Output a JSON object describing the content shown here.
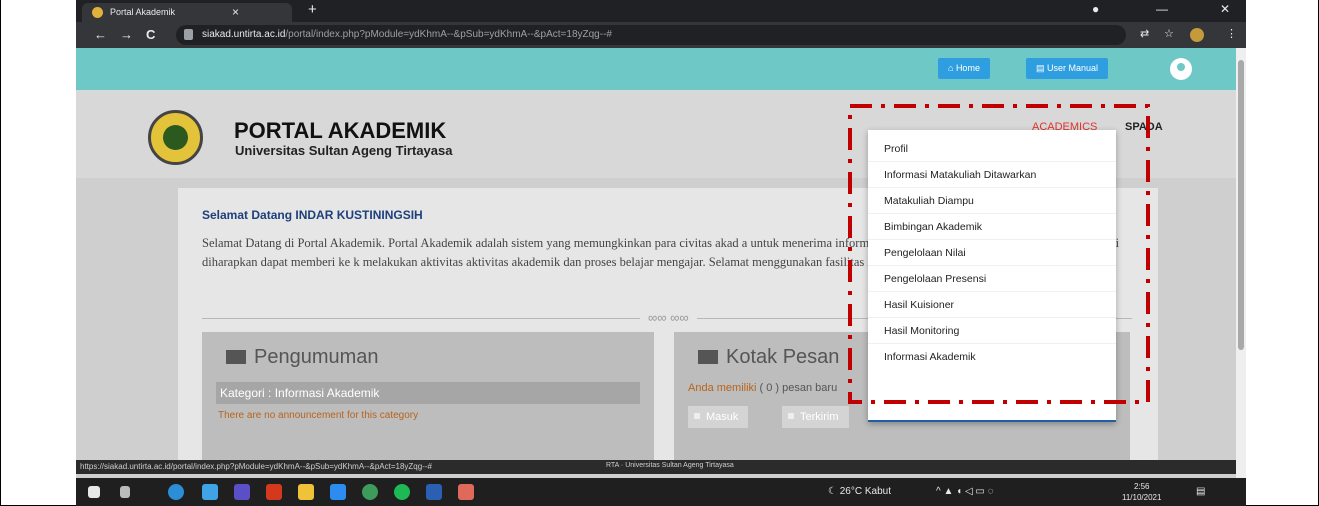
{
  "browser": {
    "tab_title": "Portal Akademik",
    "tab_close": "×",
    "new_tab": "+",
    "back": "←",
    "forward": "→",
    "reload": "C",
    "url_host": "siakad.untirta.ac.id",
    "url_path": "/portal/index.php?pModule=ydKhmA--&pSub=ydKhmA--&pAct=18yZqg--#",
    "win_min": "—",
    "win_max": "❐",
    "win_close": "✕"
  },
  "topbar": {
    "home_label": "Home",
    "manual_label": "User Manual"
  },
  "header": {
    "title": "PORTAL AKADEMIK",
    "subtitle": "Universitas Sultan Ageng Tirtayasa",
    "nav_academics": "ACADEMICS",
    "nav_spada": "SPADA"
  },
  "welcome": {
    "title": "Selamat Datang INDAR KUSTININGSIH",
    "text": "Selamat Datang di Portal Akademik. Portal Akademik adalah sistem yang memungkinkan para civitas akad a untuk menerima informasi dengan lebih cepat melalui Internet. Sistem ini diharapkan dapat memberi ke k melakukan aktivitas aktivitas akademik dan proses belajar mengajar. Selamat menggunakan fasilitas ini.",
    "flourish": "∞∞ ∞∞"
  },
  "pengumuman": {
    "title": "Pengumuman",
    "category": "Kategori : Informasi Akademik",
    "empty": "There are no announcement for this category"
  },
  "pesan": {
    "title": "Kotak Pesan",
    "count_prefix": "Anda memiliki",
    "count_value": "( 0 )",
    "count_suffix": "pesan baru",
    "inbox_label": "Masuk",
    "sent_label": "Terkirim"
  },
  "dropdown": {
    "items": [
      "Profil",
      "Informasi Matakuliah Ditawarkan",
      "Matakuliah Diampu",
      "Bimbingan Akademik",
      "Pengelolaan Nilai",
      "Pengelolaan Presensi",
      "Hasil Kuisioner",
      "Hasil Monitoring",
      "Informasi Akademik"
    ]
  },
  "statusbar": {
    "link_url": "https://siakad.untirta.ac.id/portal/index.php?pModule=ydKhmA--&pSub=ydKhmA--&pAct=18yZqg--#",
    "footer_text": "RTA · Universitas Sultan Ageng Tirtayasa"
  },
  "taskbar": {
    "weather": "26°C Kabut",
    "time": "2:56",
    "date": "11/10/2021"
  },
  "colors": {
    "topbar": "#6ec9c6",
    "accent_red": "#e0332e",
    "highlight": "#c00000",
    "button_blue": "#2f9ee0"
  }
}
